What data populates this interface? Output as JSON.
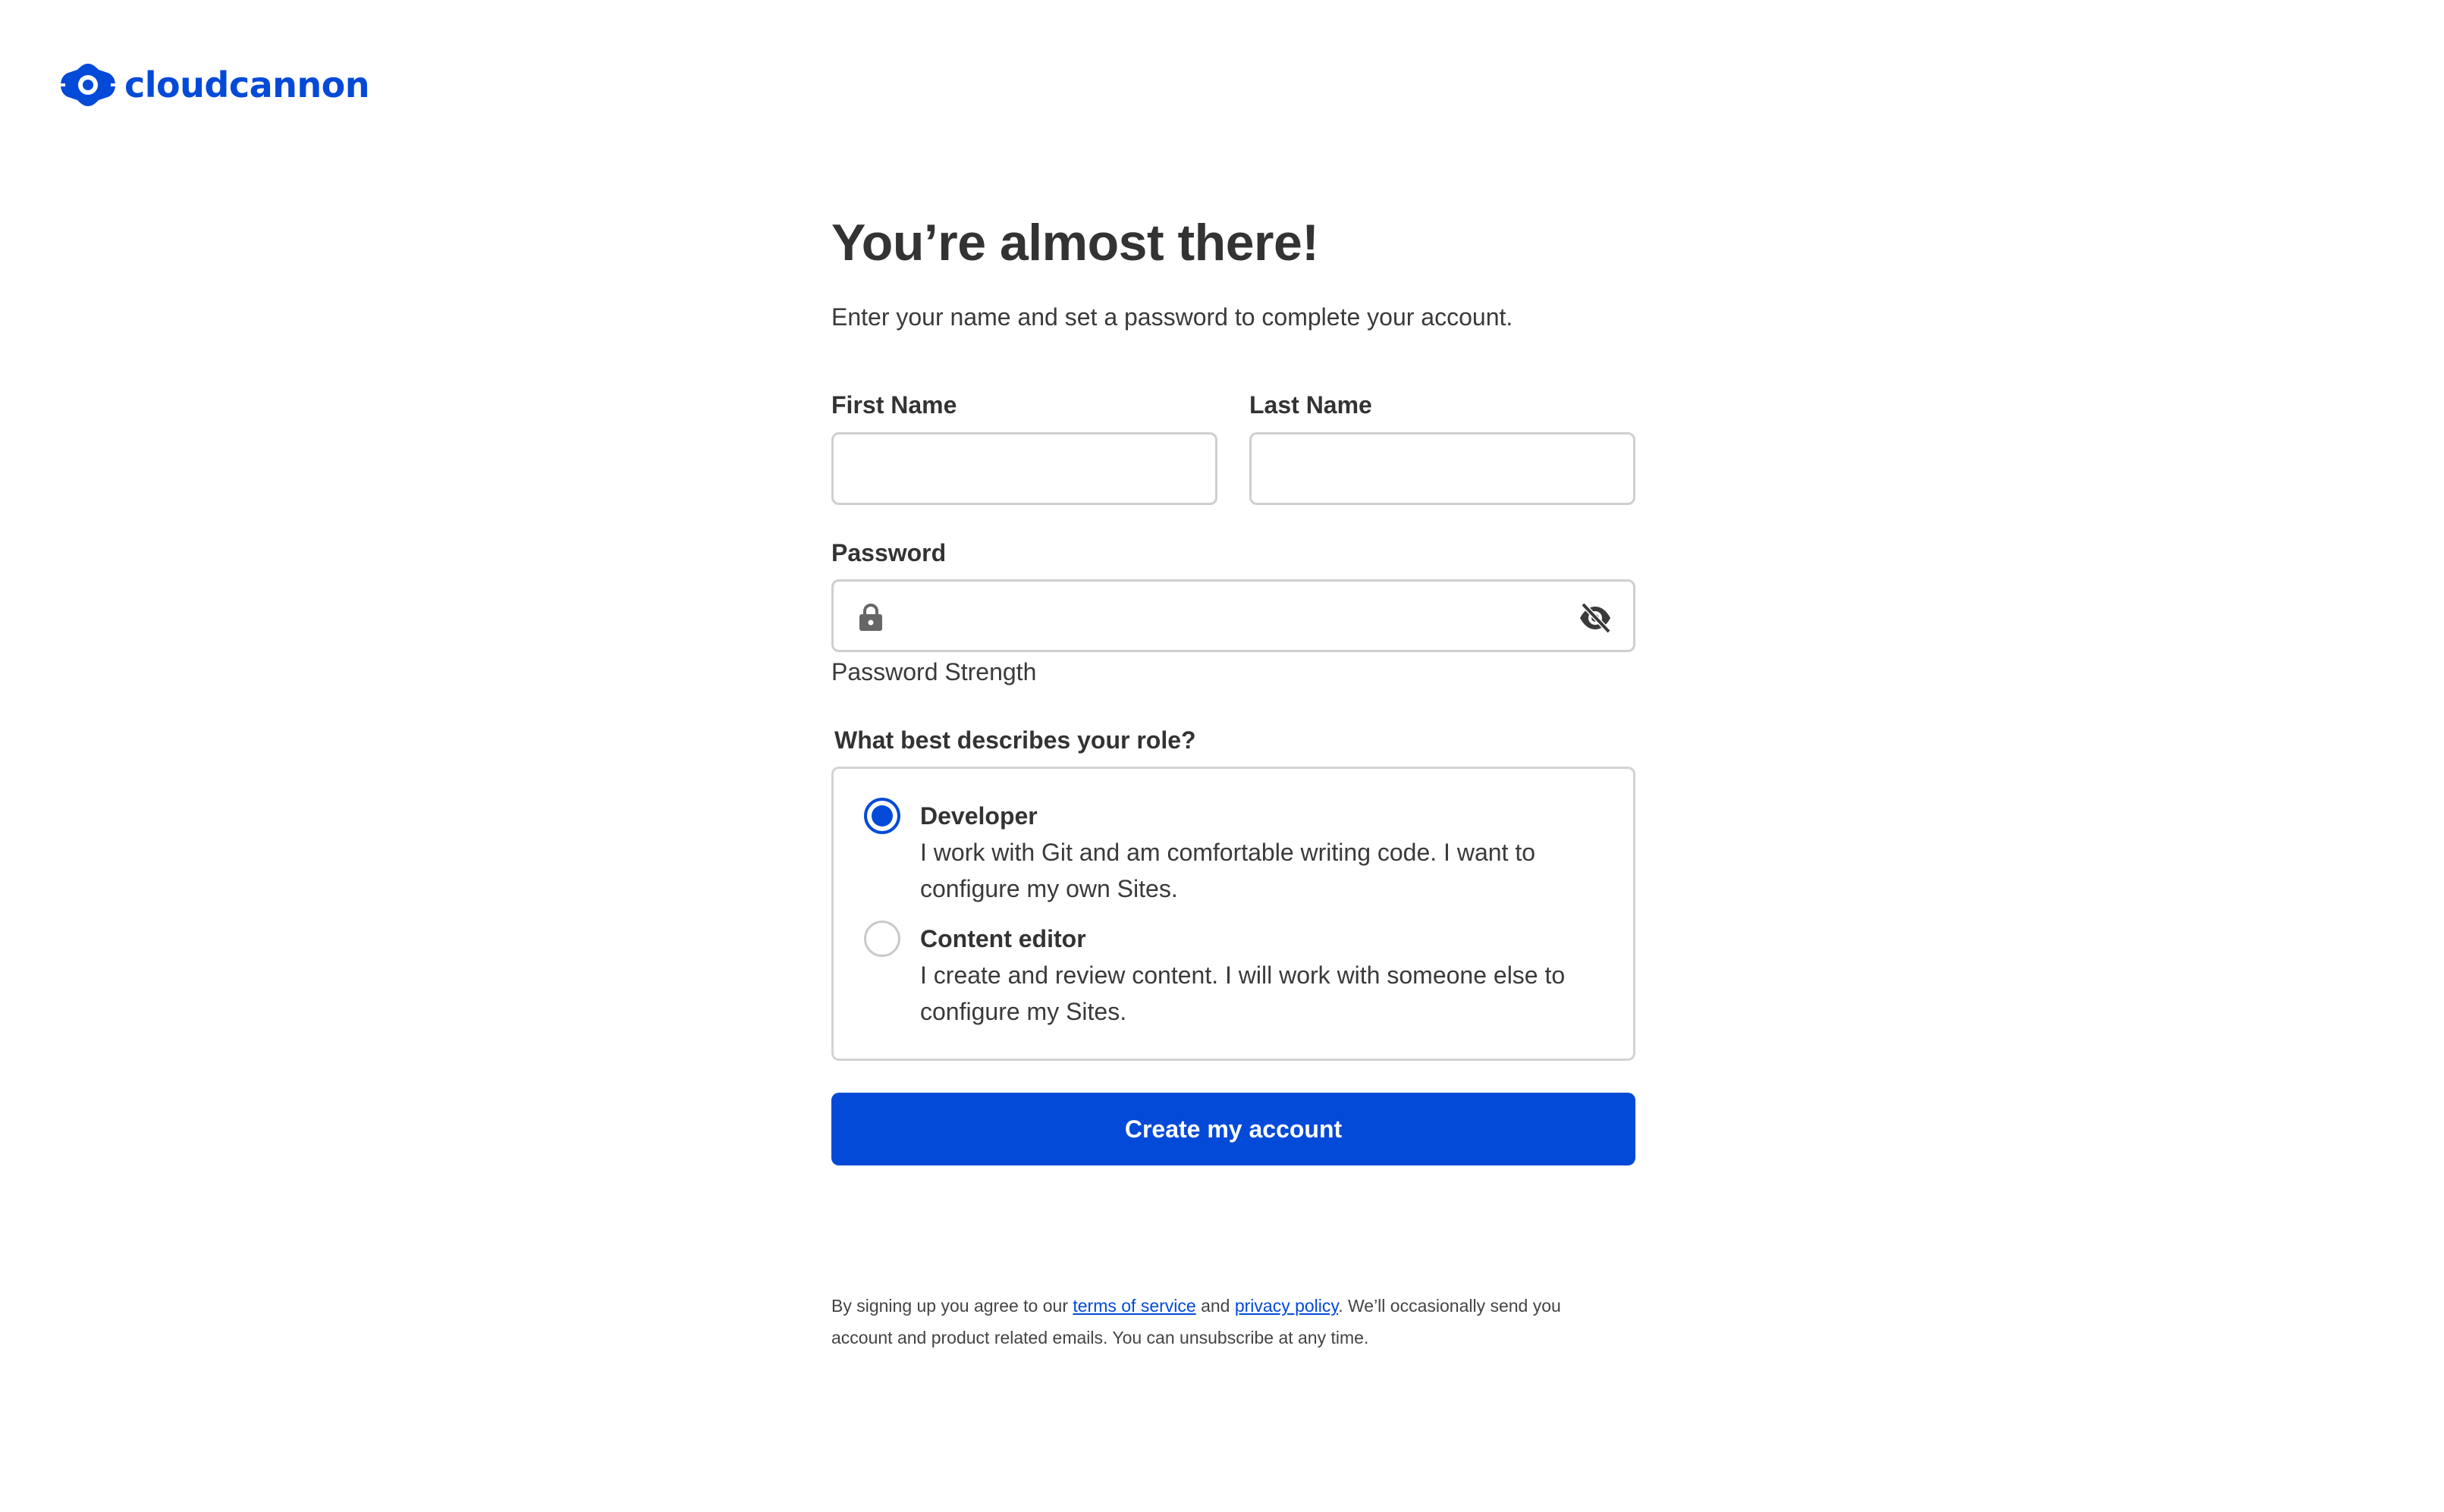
{
  "brand": {
    "name": "cloudcannon",
    "logo_icon": "cloudcannon-logo-icon",
    "color": "#034ad8"
  },
  "form": {
    "title": "You’re almost there!",
    "subtitle": "Enter your name and set a password to complete your account.",
    "first_name": {
      "label": "First Name",
      "value": "",
      "placeholder": ""
    },
    "last_name": {
      "label": "Last Name",
      "value": "",
      "placeholder": ""
    },
    "password": {
      "label": "Password",
      "value": "",
      "placeholder": "",
      "leading_icon": "lock-icon",
      "trailing_icon": "eye-off-icon",
      "strength_label": "Password Strength"
    },
    "role": {
      "label": "What best describes your role?",
      "selected": "developer",
      "options": [
        {
          "id": "developer",
          "title": "Developer",
          "description": "I work with Git and am comfortable writing code. I want to configure my own Sites."
        },
        {
          "id": "content-editor",
          "title": "Content editor",
          "description": "I create and review content. I will work with someone else to configure my Sites."
        }
      ]
    },
    "submit_label": "Create my account"
  },
  "legal": {
    "prefix": "By signing up you agree to our ",
    "terms_link": "terms of service",
    "and": " and ",
    "privacy_link": "privacy policy",
    "suffix": ". We’ll occasionally send you account and product related emails. You can unsubscribe at any time."
  }
}
